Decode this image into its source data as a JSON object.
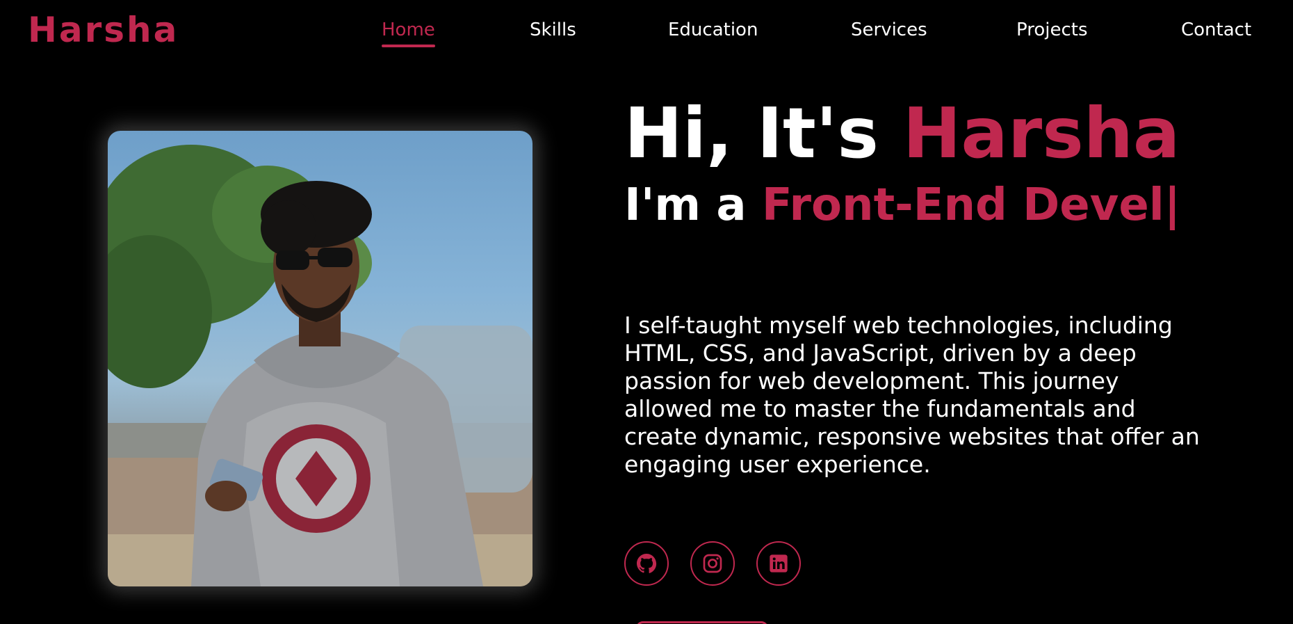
{
  "brand": {
    "logo_text": "Harsha",
    "accent_color": "#c0284f"
  },
  "nav": {
    "items": [
      {
        "label": "Home",
        "active": true
      },
      {
        "label": "Skills",
        "active": false
      },
      {
        "label": "Education",
        "active": false
      },
      {
        "label": "Services",
        "active": false
      },
      {
        "label": "Projects",
        "active": false
      },
      {
        "label": "Contact",
        "active": false
      }
    ]
  },
  "hero": {
    "greeting_prefix": "Hi, It's ",
    "greeting_name": "Harsha",
    "role_prefix": "I'm a ",
    "role_typed": "Front-End Devel|",
    "description": "I self-taught myself web technologies, including HTML, CSS, and JavaScript, driven by a deep passion for web development. This journey allowed me to master the fundamentals and create dynamic, responsive websites that offer an engaging user experience."
  },
  "social": [
    {
      "icon": "github-icon"
    },
    {
      "icon": "instagram-icon"
    },
    {
      "icon": "linkedin-icon"
    }
  ]
}
